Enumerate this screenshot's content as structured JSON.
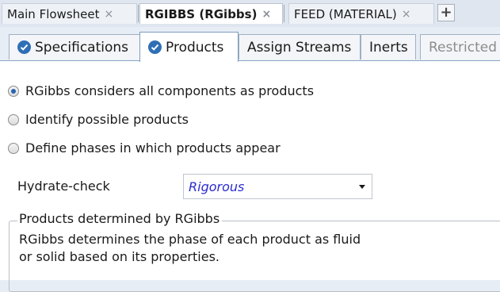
{
  "doc_tabs": [
    {
      "label": "Main Flowsheet",
      "close": "×",
      "active": false
    },
    {
      "label": "RGIBBS (RGibbs)",
      "close": "×",
      "active": true
    },
    {
      "label": "FEED (MATERIAL)",
      "close": "×",
      "active": false
    }
  ],
  "new_tab_label": "+",
  "form_tabs": [
    {
      "label": "Specifications",
      "status_icon": "check-circle-icon"
    },
    {
      "label": "Products",
      "status_icon": "check-circle-icon",
      "active": true
    },
    {
      "label": "Assign Streams"
    },
    {
      "label": "Inerts"
    },
    {
      "label": "Restricted E",
      "disabled": true
    }
  ],
  "options": [
    {
      "label": "RGibbs considers all components as products",
      "selected": true
    },
    {
      "label": "Identify possible products",
      "selected": false
    },
    {
      "label": "Define phases in which products appear",
      "selected": false
    }
  ],
  "hydrate_check": {
    "label": "Hydrate-check",
    "value": "Rigorous"
  },
  "products_group": {
    "title": "Products determined by RGibbs",
    "line1": "RGibbs determines the phase of each product as fluid",
    "line2": "or solid based on its properties."
  },
  "colors": {
    "accent": "#2f6fb6",
    "value_text": "#2c2ccf",
    "background": "#e7edf5"
  }
}
